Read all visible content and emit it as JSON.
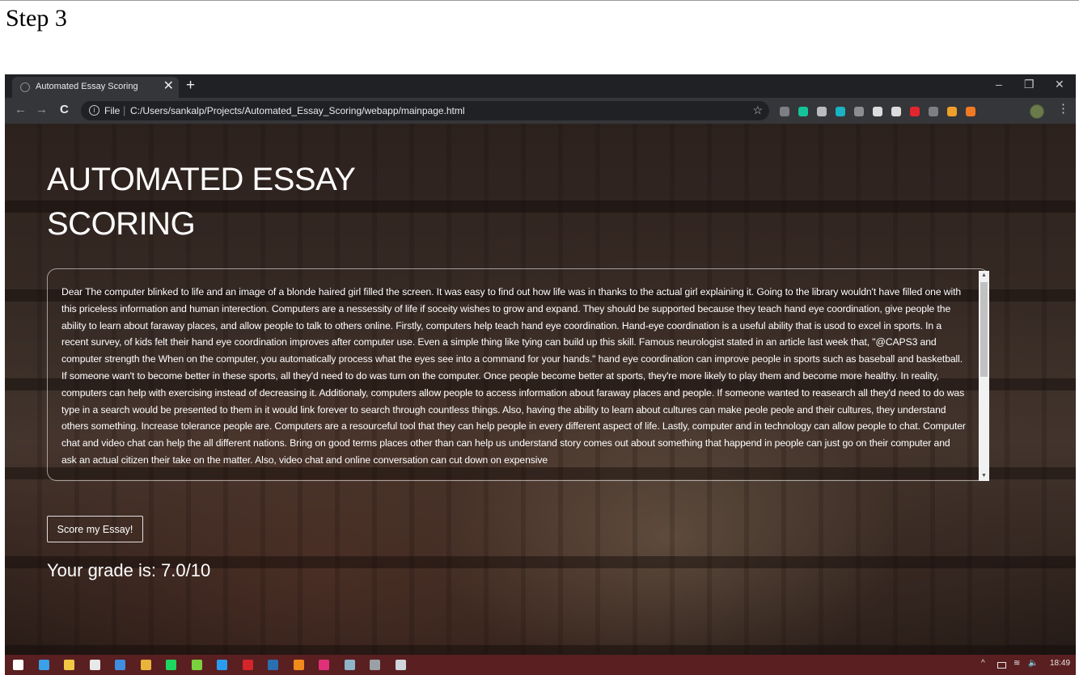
{
  "doc": {
    "step_label": "Step 3"
  },
  "browser": {
    "tab": {
      "title": "Automated Essay Scoring"
    },
    "newtab_symbol": "+",
    "window_controls": {
      "minimize": "–",
      "restore": "❐",
      "close": "✕"
    },
    "nav": {
      "back": "←",
      "forward": "→",
      "reload": "C"
    },
    "address": {
      "info_symbol": "i",
      "prefix": "File",
      "separator": "|",
      "url": "C:/Users/sankalp/Projects/Automated_Essay_Scoring/webapp/mainpage.html"
    },
    "bookmark_symbol": "☆",
    "menu_symbol": "⋮",
    "extensions": [
      {
        "name": "extension-e-icon",
        "color": "#7d7f84"
      },
      {
        "name": "grammarly-icon",
        "color": "#15c39a"
      },
      {
        "name": "camera-icon",
        "color": "#b9bbbe"
      },
      {
        "name": "circle-teal-icon",
        "color": "#19b3c2"
      },
      {
        "name": "puzzle-icon",
        "color": "#8b8d91"
      },
      {
        "name": "compass-icon",
        "color": "#dcdcdc"
      },
      {
        "name": "list-icon",
        "color": "#dcdcdc"
      },
      {
        "name": "shield-red-icon",
        "color": "#e3262e"
      },
      {
        "name": "square-gray-icon",
        "color": "#7d7f84"
      },
      {
        "name": "w-logo-icon",
        "color": "#f0a02a"
      },
      {
        "name": "notification-badge-icon",
        "color": "#f07a22"
      }
    ]
  },
  "page": {
    "title": "AUTOMATED ESSAY SCORING",
    "essay": "Dear The computer blinked to life and an image of a blonde haired girl filled the screen. It was easy to find out how life was in thanks to the actual girl explaining it. Going to the library wouldn't have filled one with this priceless information and human interection. Computers are a nessessity of life if soceity wishes to grow and expand. They should be supported because they teach hand eye coordination, give people the ability to learn about faraway places, and allow people to talk to others online. Firstly, computers help teach hand eye coordination. Hand-eye coordination is a useful ability that is usod to excel in sports. In a recent survey, of kids felt their hand eye coordination improves after computer use. Even a simple thing like tying can build up this skill. Famous neurologist stated in an article last week that, \"@CAPS3 and computer strength the When on the computer, you automatically process what the eyes see into a command for your hands.\" hand eye coordination can improve people in sports such as baseball and basketball. If someone wan't to become better in these sports, all they'd need to do was turn on the computer. Once people become better at sports, they're more likely to play them and become more healthy. In reality, computers can help with exercising instead of decreasing it. Additionaly, computers allow people to access information about faraway places and people. If someone wanted to reasearch all they'd need to do was type in a search would be presented to them in it would link forever to search through countless things. Also, having the ability to learn about cultures can make peole peole and their cultures, they understand others something. Increase tolerance people are. Computers are a resourceful tool that they can help people in every different aspect of life. Lastly, computer and in technology can allow people to chat. Computer chat and video chat can help the all different nations. Bring on good terms places other than can help us understand story comes out about something that happend in people can just go on their computer and ask an actual citizen their take on the matter. Also, video chat and online conversation can cut down on expensive",
    "button_label": "Score my Essay!",
    "grade": "Your grade is: 7.0/10",
    "scroll_up_symbol": "▲",
    "scroll_down_symbol": "▼"
  },
  "taskbar": {
    "apps": [
      {
        "name": "windows-start-icon",
        "color": "#ffffff"
      },
      {
        "name": "edge-icon",
        "color": "#3aa0e8"
      },
      {
        "name": "file-explorer-icon",
        "color": "#f2c744"
      },
      {
        "name": "store-icon",
        "color": "#e8e8e8"
      },
      {
        "name": "mail-icon",
        "color": "#3f8ee0"
      },
      {
        "name": "chrome-icon",
        "color": "#e8b53a"
      },
      {
        "name": "spotify-icon",
        "color": "#1ed760"
      },
      {
        "name": "green-ring-icon",
        "color": "#7bd13d"
      },
      {
        "name": "vscode-icon",
        "color": "#2a9cf0"
      },
      {
        "name": "red-app-icon",
        "color": "#d4252a"
      },
      {
        "name": "photoshop-icon",
        "color": "#2a6fb0"
      },
      {
        "name": "illustrator-icon",
        "color": "#f08a1a"
      },
      {
        "name": "indesign-icon",
        "color": "#e0307a"
      },
      {
        "name": "monitor-icon",
        "color": "#8fb4c9"
      },
      {
        "name": "calculator-icon",
        "color": "#9aa0a6"
      },
      {
        "name": "notes-icon",
        "color": "#cfd6dc"
      }
    ],
    "tray": {
      "chevron": "^",
      "volume": "🔈",
      "time": "18:49"
    }
  }
}
